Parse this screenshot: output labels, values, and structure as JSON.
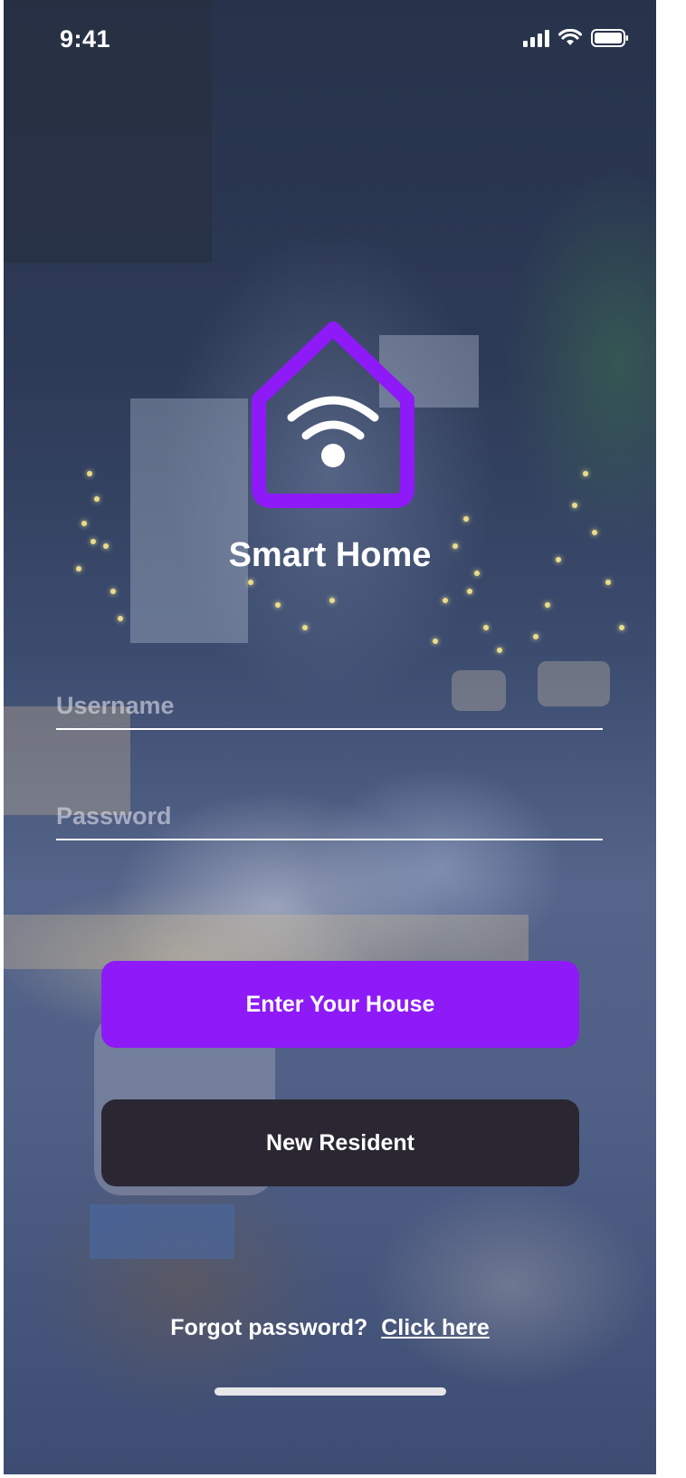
{
  "status_bar": {
    "time": "9:41"
  },
  "app": {
    "title": "Smart Home",
    "logo_icon": "smart-home-wifi-icon",
    "brand_color": "#8e1af7"
  },
  "login": {
    "username_placeholder": "Username",
    "username_value": "",
    "password_placeholder": "Password",
    "password_value": ""
  },
  "buttons": {
    "primary_label": "Enter Your House",
    "secondary_label": "New Resident"
  },
  "footer": {
    "forgot_text": "Forgot password?",
    "forgot_link": "Click here"
  }
}
